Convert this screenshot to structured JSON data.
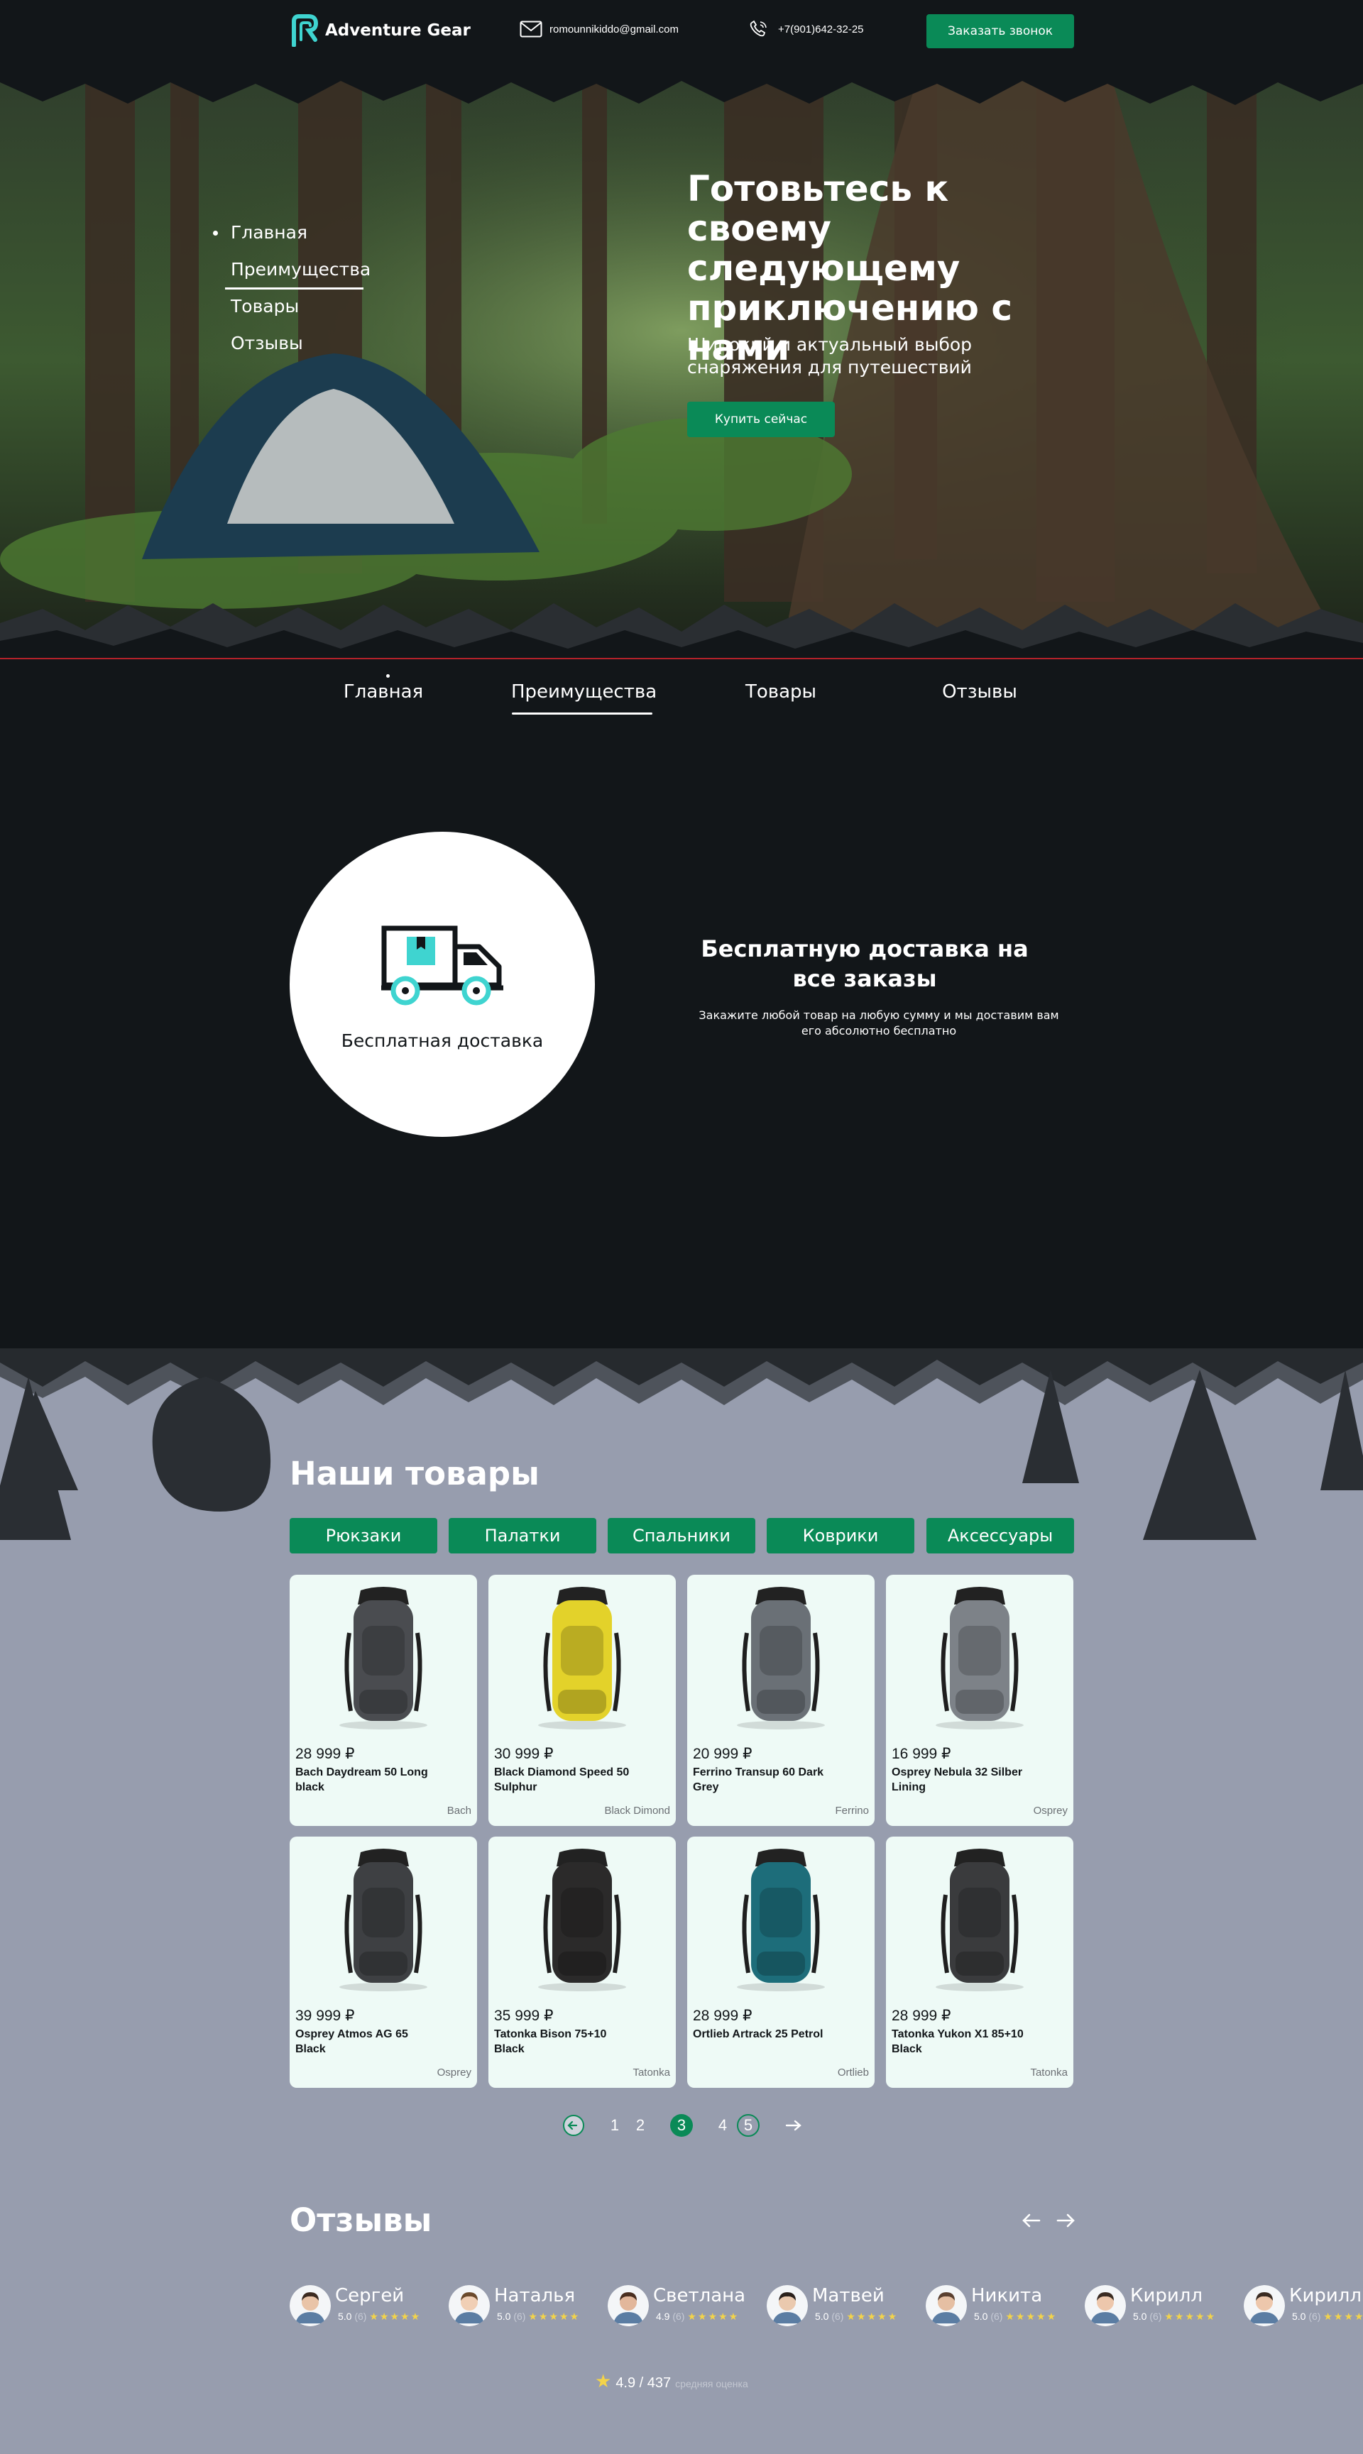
{
  "header": {
    "logo_text": "Adventure Gear",
    "email": "romounnikiddo@gmail.com",
    "phone": "+7(901)642-32-25",
    "call_button": "Заказать звонок"
  },
  "hero": {
    "nav": [
      "Главная",
      "Преимущества",
      "Товары",
      "Отзывы"
    ],
    "title": "Готовьтесь к своему следующему приключению с нами",
    "subtitle": "Широкий и актуальный выбор снаряжения для путешествий",
    "buy_button": "Купить сейчас"
  },
  "section_nav": [
    "Главная",
    "Преимущества",
    "Товары",
    "Отзывы"
  ],
  "delivery": {
    "circle_label": "Бесплатная доставка",
    "title": "Бесплатную доставка на все заказы",
    "text": "Закажите любой товар на любую сумму и мы доставим вам его абсолютно бесплатно"
  },
  "products": {
    "title": "Наши товары",
    "categories": [
      "Рюкзаки",
      "Палатки",
      "Спальники",
      "Коврики",
      "Аксессуары"
    ],
    "items": [
      {
        "price": "28 999 ₽",
        "name": "Bach Daydream 50 Long black",
        "brand": "Bach",
        "color": "#4a4c50"
      },
      {
        "price": "30 999 ₽",
        "name": "Black Diamond Speed 50 Sulphur",
        "brand": "Black Dimond",
        "color": "#e3d22a"
      },
      {
        "price": "20 999 ₽",
        "name": "Ferrino Transup 60 Dark Grey",
        "brand": "Ferrino",
        "color": "#6a7076"
      },
      {
        "price": "16 999 ₽",
        "name": "Osprey Nebula 32 Silber Lining",
        "brand": "Osprey",
        "color": "#7d8288"
      },
      {
        "price": "39 999 ₽",
        "name": "Osprey Atmos AG 65 Black",
        "brand": "Osprey",
        "color": "#3e4043"
      },
      {
        "price": "35 999 ₽",
        "name": "Tatonka Bison 75+10 Black",
        "brand": "Tatonka",
        "color": "#2b2a2a"
      },
      {
        "price": "28 999 ₽",
        "name": "Ortlieb Artrack 25 Petrol",
        "brand": "Ortlieb",
        "color": "#1d6d7a"
      },
      {
        "price": "28 999 ₽",
        "name": "Tatonka Yukon X1 85+10 Black",
        "brand": "Tatonka",
        "color": "#3a3b3d"
      }
    ],
    "pages": [
      "1",
      "2",
      "3",
      "4",
      "5"
    ],
    "current_page": "3"
  },
  "reviews": {
    "title": "Отзывы",
    "people": [
      {
        "name": "Сергей",
        "score": "5.0",
        "count": "(6)",
        "stars": "★★★★★"
      },
      {
        "name": "Наталья",
        "score": "5.0",
        "count": "(6)",
        "stars": "★★★★★"
      },
      {
        "name": "Светлана",
        "score": "4.9",
        "count": "(6)",
        "stars": "★★★★★"
      },
      {
        "name": "Матвей",
        "score": "5.0",
        "count": "(6)",
        "stars": "★★★★★"
      },
      {
        "name": "Никита",
        "score": "5.0",
        "count": "(6)",
        "stars": "★★★★★"
      },
      {
        "name": "Кирилл",
        "score": "5.0",
        "count": "(6)",
        "stars": "★★★★★"
      },
      {
        "name": "Кирилл",
        "score": "5.0",
        "count": "(6)",
        "stars": "★★★★★"
      }
    ],
    "average": "4.9 / 437",
    "average_label": "средняя оценка"
  },
  "colors": {
    "accent": "#0a8a57",
    "dark": "#121619",
    "products_bg": "#979dae",
    "card_bg": "#eefaf6",
    "star": "#f3d34a"
  }
}
